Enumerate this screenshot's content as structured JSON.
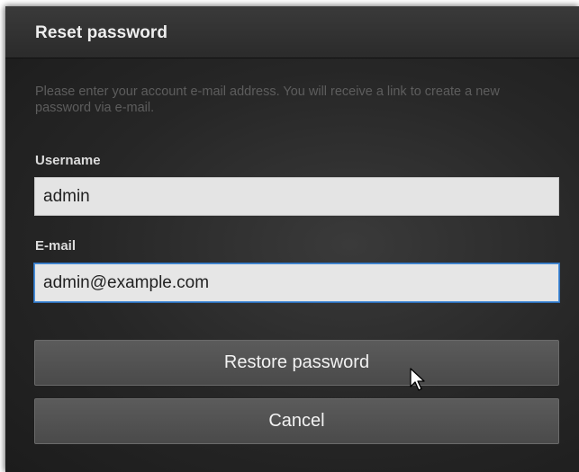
{
  "dialog": {
    "title": "Reset password",
    "description": "Please enter your account e-mail address. You will receive a link to create a new password via e-mail.",
    "username": {
      "label": "Username",
      "value": "admin"
    },
    "email": {
      "label": "E-mail",
      "value": "admin@example.com"
    },
    "buttons": {
      "restore_label": "Restore password",
      "cancel_label": "Cancel"
    }
  },
  "icons": {
    "cursor": "mouse-pointer-icon"
  },
  "colors": {
    "dialog_background": "#1f1f1f",
    "header_background": "#333333",
    "input_background": "#e4e4e4",
    "focus_border": "#4a8fd8",
    "button_background": "#525252",
    "description_text": "#5d5d5d"
  }
}
